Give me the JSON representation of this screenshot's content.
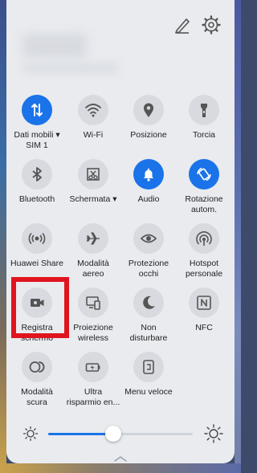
{
  "header": {
    "edit_icon": "pencil-edit-icon",
    "settings_icon": "gear-icon"
  },
  "tiles": [
    {
      "id": "mobile-data",
      "label": "Dati mobili ▾\nSIM 1",
      "on": true,
      "icon": "mobile-data-arrows-icon"
    },
    {
      "id": "wifi",
      "label": "Wi-Fi",
      "on": false,
      "icon": "wifi-icon"
    },
    {
      "id": "location",
      "label": "Posizione",
      "on": false,
      "icon": "location-pin-icon"
    },
    {
      "id": "torch",
      "label": "Torcia",
      "on": false,
      "icon": "flashlight-icon"
    },
    {
      "id": "bluetooth",
      "label": "Bluetooth",
      "on": false,
      "icon": "bluetooth-icon"
    },
    {
      "id": "screenshot",
      "label": "Schermata ▾",
      "on": false,
      "icon": "screenshot-icon"
    },
    {
      "id": "audio",
      "label": "Audio",
      "on": true,
      "icon": "bell-icon"
    },
    {
      "id": "auto-rotate",
      "label": "Rotazione\nautom.",
      "on": true,
      "icon": "rotate-icon"
    },
    {
      "id": "huawei-share",
      "label": "Huawei Share",
      "on": false,
      "icon": "huawei-share-icon"
    },
    {
      "id": "airplane",
      "label": "Modalità\naereo",
      "on": false,
      "icon": "airplane-icon"
    },
    {
      "id": "eye-protection",
      "label": "Protezione\nocchi",
      "on": false,
      "icon": "eye-icon"
    },
    {
      "id": "hotspot",
      "label": "Hotspot\npersonale",
      "on": false,
      "icon": "hotspot-icon"
    },
    {
      "id": "screen-record",
      "label": "Registra\nschermo",
      "on": false,
      "icon": "video-camera-icon"
    },
    {
      "id": "wireless-projection",
      "label": "Proiezione\nwireless",
      "on": false,
      "icon": "projection-icon"
    },
    {
      "id": "do-not-disturb",
      "label": "Non\ndisturbare",
      "on": false,
      "icon": "moon-icon"
    },
    {
      "id": "nfc",
      "label": "NFC",
      "on": false,
      "icon": "nfc-icon"
    },
    {
      "id": "dark-mode",
      "label": "Modalità\nscura",
      "on": false,
      "icon": "dark-mode-icon"
    },
    {
      "id": "ultra-power-saving",
      "label": "Ultra\nrisparmio en...",
      "on": false,
      "icon": "battery-saver-icon"
    },
    {
      "id": "quick-menu",
      "label": "Menu veloce",
      "on": false,
      "icon": "quick-menu-icon"
    }
  ],
  "brightness": {
    "level": 0.45,
    "low_icon": "sun-small-icon",
    "high_icon": "sun-large-icon"
  },
  "colors": {
    "accent": "#1a73e8",
    "tile_off": "#d8dadf",
    "highlight": "#e0141e",
    "panel": "#e9ebef"
  }
}
